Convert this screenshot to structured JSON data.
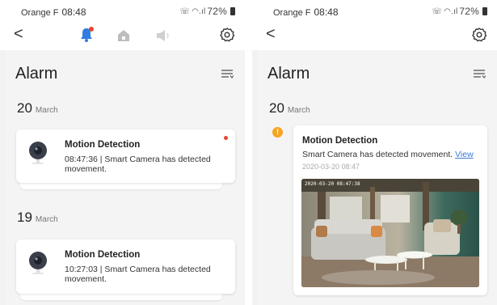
{
  "left": {
    "status": {
      "carrier": "Orange F",
      "time": "08:48",
      "battery": "72%"
    },
    "nav": {
      "back": "<"
    },
    "page_title": "Alarm",
    "groups": [
      {
        "day": "20",
        "month": "March",
        "items": [
          {
            "title": "Motion Detection",
            "description": "08:47:36 | Smart Camera has detected movement.",
            "unread": true
          }
        ]
      },
      {
        "day": "19",
        "month": "March",
        "items": [
          {
            "title": "Motion Detection",
            "description": "10:27:03 | Smart Camera has detected movement.",
            "unread": false
          }
        ]
      }
    ]
  },
  "right": {
    "status": {
      "carrier": "Orange F",
      "time": "08:48",
      "battery": "72%"
    },
    "nav": {
      "back": "<"
    },
    "page_title": "Alarm",
    "group": {
      "day": "20",
      "month": "March"
    },
    "event": {
      "badge": "!",
      "title": "Motion Detection",
      "description": "Smart Camera has detected movement.",
      "link": "View",
      "timestamp": "2020-03-20 08:47",
      "snapshot_stamp": "2020-03-20 08:47:38"
    }
  },
  "colors": {
    "accent_blue": "#2f7de1",
    "unread_red": "#e8442c",
    "alert_orange": "#f5a623",
    "link_blue": "#3a78d4"
  },
  "icons": [
    "bell-icon",
    "home-icon",
    "speaker-icon",
    "gear-icon",
    "list-filter-icon",
    "camera-icon"
  ]
}
